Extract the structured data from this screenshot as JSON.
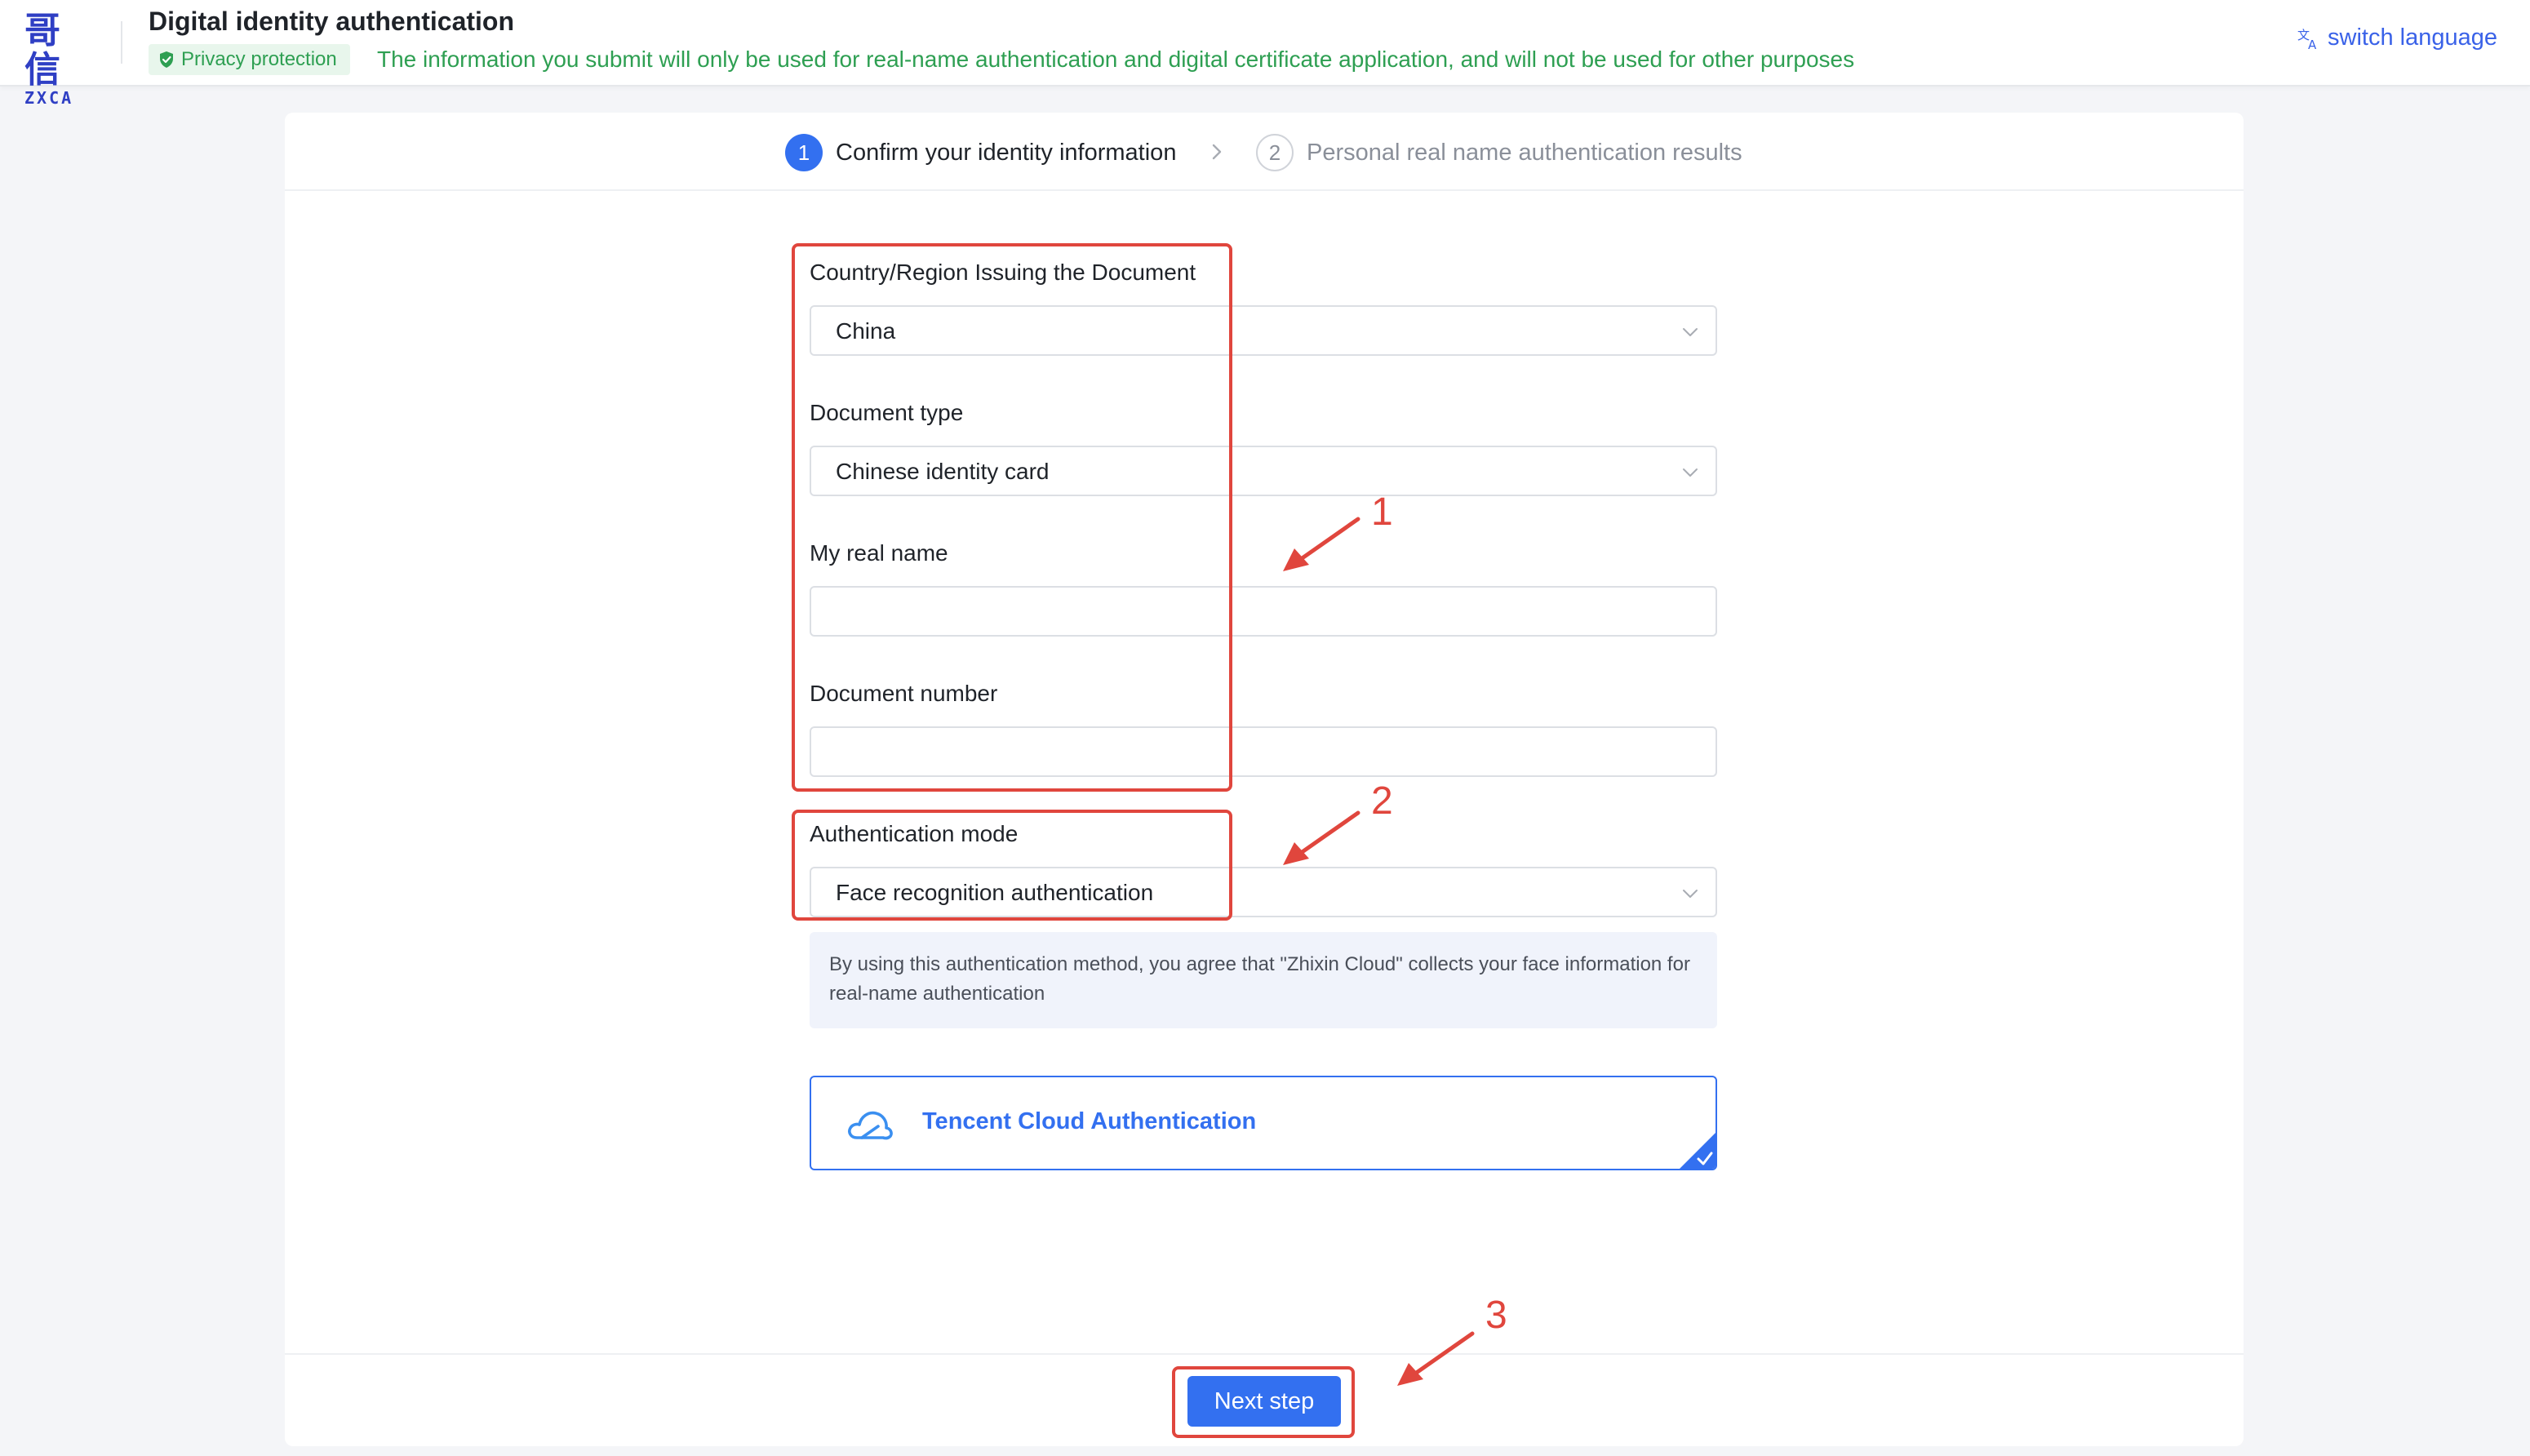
{
  "header": {
    "logo_mark": "哥信",
    "logo_text": "ZXCA",
    "title": "Digital identity authentication",
    "privacy_badge": "Privacy protection",
    "privacy_note": "The information you submit will only be used for real-name authentication and digital certificate application, and will not be used for other purposes",
    "switch_language": "switch language"
  },
  "steps": [
    {
      "number": "1",
      "label": "Confirm your identity information",
      "active": true
    },
    {
      "number": "2",
      "label": "Personal real name authentication results",
      "active": false
    }
  ],
  "form": {
    "country": {
      "label": "Country/Region Issuing the Document",
      "value": "China"
    },
    "document_type": {
      "label": "Document type",
      "value": "Chinese identity card"
    },
    "real_name": {
      "label": "My real name",
      "value": "",
      "placeholder": ""
    },
    "document_number": {
      "label": "Document number",
      "value": "",
      "placeholder": ""
    },
    "auth_mode": {
      "label": "Authentication mode",
      "value": "Face recognition authentication"
    },
    "notice": "By using this authentication method, you agree that \"Zhixin Cloud\" collects your face information for real-name authentication",
    "provider": {
      "label": "Tencent Cloud Authentication",
      "selected": true
    }
  },
  "next_button": "Next step",
  "annotations": [
    "1",
    "2",
    "3"
  ],
  "colors": {
    "primary": "#3370f0",
    "privacy_green": "#2e9f52",
    "annotation_red": "#e0463d",
    "logo_blue": "#2f3fc4"
  }
}
